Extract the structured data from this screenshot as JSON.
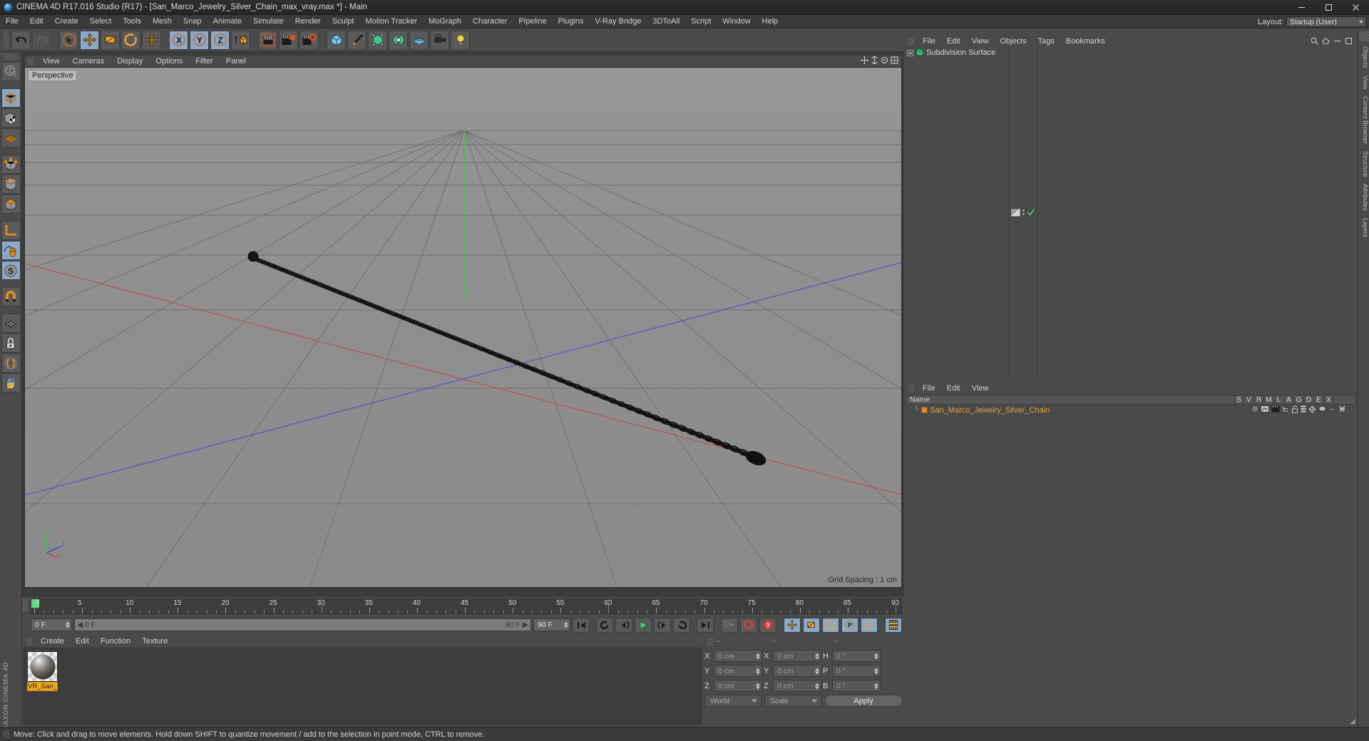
{
  "window": {
    "title": "CINEMA 4D R17.016 Studio (R17) - [San_Marco_Jewelry_Silver_Chain_max_vray.max *] - Main",
    "app_icon": "cinema4d-logo-icon",
    "minimize": "—",
    "maximize": "❐",
    "close": "✕"
  },
  "menubar": {
    "items": [
      {
        "label": "File"
      },
      {
        "label": "Edit"
      },
      {
        "label": "Create"
      },
      {
        "label": "Select"
      },
      {
        "label": "Tools"
      },
      {
        "label": "Mesh"
      },
      {
        "label": "Snap"
      },
      {
        "label": "Animate"
      },
      {
        "label": "Simulate"
      },
      {
        "label": "Render"
      },
      {
        "label": "Sculpt"
      },
      {
        "label": "Motion Tracker"
      },
      {
        "label": "MoGraph"
      },
      {
        "label": "Character"
      },
      {
        "label": "Pipeline"
      },
      {
        "label": "Plugins"
      },
      {
        "label": "V-Ray Bridge"
      },
      {
        "label": "3DToAll"
      },
      {
        "label": "Script"
      },
      {
        "label": "Window"
      },
      {
        "label": "Help"
      }
    ],
    "layout_label": "Layout:",
    "layout_value": "Startup (User)"
  },
  "toolbar": {
    "buttons": [
      {
        "name": "undo-button",
        "icon": "undo-arrow-icon",
        "state": "normal"
      },
      {
        "name": "redo-button",
        "icon": "redo-arrow-icon",
        "state": "dim"
      },
      {
        "name": "live-selection-tool",
        "icon": "cursor-circle-icon",
        "state": "normal"
      },
      {
        "name": "move-tool",
        "icon": "move-arrows-icon",
        "state": "active"
      },
      {
        "name": "scale-tool",
        "icon": "scale-box-icon",
        "state": "normal"
      },
      {
        "name": "rotate-tool",
        "icon": "rotate-ring-icon",
        "state": "normal"
      },
      {
        "name": "global-move-tool",
        "icon": "move-arrows-icon",
        "state": "normal"
      },
      {
        "name": "lock-x-axis",
        "icon": "axis-x-icon",
        "state": "active"
      },
      {
        "name": "lock-y-axis",
        "icon": "axis-y-icon",
        "state": "active"
      },
      {
        "name": "lock-z-axis",
        "icon": "axis-z-icon",
        "state": "active"
      },
      {
        "name": "world-object-coordinates",
        "icon": "world-coordinate-icon",
        "state": "normal"
      },
      {
        "name": "render-view-button",
        "icon": "clapperboard-icon",
        "state": "normal"
      },
      {
        "name": "render-to-picture-viewer",
        "icon": "clapperboard-render-icon",
        "state": "normal"
      },
      {
        "name": "render-settings",
        "icon": "clapperboard-gear-icon",
        "state": "normal"
      },
      {
        "name": "add-cube-object",
        "icon": "cube-primitive-icon",
        "state": "normal"
      },
      {
        "name": "add-spline-object",
        "icon": "pen-spline-icon",
        "state": "normal"
      },
      {
        "name": "add-generator-object",
        "icon": "generator-nurbs-icon",
        "state": "normal"
      },
      {
        "name": "add-deformer-object",
        "icon": "deformer-icon",
        "state": "normal"
      },
      {
        "name": "add-environment-object",
        "icon": "floor-environment-icon",
        "state": "normal"
      },
      {
        "name": "add-camera-object",
        "icon": "camera-icon",
        "state": "normal"
      },
      {
        "name": "add-light-object",
        "icon": "light-bulb-icon",
        "state": "normal"
      }
    ]
  },
  "left_palette": {
    "buttons": [
      {
        "name": "make-editable-tool",
        "icon": "globe-wireframe-icon",
        "state": "normal"
      },
      {
        "name": "model-mode",
        "icon": "model-cube-icon",
        "state": "active"
      },
      {
        "name": "texture-mode",
        "icon": "texture-cube-icon",
        "state": "normal"
      },
      {
        "name": "workplane-mode",
        "icon": "workplane-grid-icon",
        "state": "normal"
      },
      {
        "name": "point-mode",
        "icon": "point-cube-icon",
        "state": "normal"
      },
      {
        "name": "edge-mode",
        "icon": "edge-cube-icon",
        "state": "normal"
      },
      {
        "name": "polygon-mode",
        "icon": "polygon-cube-icon",
        "state": "normal"
      },
      {
        "name": "object-axis-mode",
        "icon": "axis-corner-icon",
        "state": "normal"
      },
      {
        "name": "enable-axis-modification",
        "icon": "mouse-axis-icon",
        "state": "active"
      },
      {
        "name": "soft-selection-tool",
        "icon": "s-circle-icon",
        "state": "active"
      },
      {
        "name": "enable-snap",
        "icon": "magnet-icon",
        "state": "normal"
      },
      {
        "name": "quantize-snap",
        "icon": "snap-grid-icon",
        "state": "normal"
      },
      {
        "name": "lock-workplane",
        "icon": "lock-icon",
        "state": "normal"
      },
      {
        "name": "open-console",
        "icon": "parentheses-icon",
        "state": "normal"
      },
      {
        "name": "python-script",
        "icon": "python-snake-icon",
        "state": "normal"
      }
    ],
    "brand": "MAXON CINEMA 4D"
  },
  "right_edge_tabs": [
    {
      "label": "Objects"
    },
    {
      "label": "View"
    },
    {
      "label": "Content Browser"
    },
    {
      "label": "Structure"
    },
    {
      "label": "Attributes"
    },
    {
      "label": "Layers"
    }
  ],
  "viewport": {
    "menus": [
      {
        "label": "View"
      },
      {
        "label": "Cameras"
      },
      {
        "label": "Display"
      },
      {
        "label": "Options"
      },
      {
        "label": "Filter"
      },
      {
        "label": "Panel"
      }
    ],
    "label": "Perspective",
    "grid_spacing": "Grid Spacing : 1 cm",
    "axis_labels": {
      "x": "X",
      "y": "Y",
      "z": "Z"
    },
    "nav_icons": [
      {
        "name": "move-camera-icon"
      },
      {
        "name": "scale-camera-icon"
      },
      {
        "name": "rotate-camera-icon"
      },
      {
        "name": "maximize-viewport-icon"
      }
    ],
    "scene_object": "silver chain model lying diagonally on ground grid"
  },
  "timeline": {
    "ticks": [
      {
        "label": "0",
        "frame": 0
      },
      {
        "label": "5",
        "frame": 5
      },
      {
        "label": "10",
        "frame": 10
      },
      {
        "label": "15",
        "frame": 15
      },
      {
        "label": "20",
        "frame": 20
      },
      {
        "label": "25",
        "frame": 25
      },
      {
        "label": "30",
        "frame": 30
      },
      {
        "label": "35",
        "frame": 35
      },
      {
        "label": "40",
        "frame": 40
      },
      {
        "label": "45",
        "frame": 45
      },
      {
        "label": "50",
        "frame": 50
      },
      {
        "label": "55",
        "frame": 55
      },
      {
        "label": "60",
        "frame": 60
      },
      {
        "label": "65",
        "frame": 65
      },
      {
        "label": "70",
        "frame": 70
      },
      {
        "label": "75",
        "frame": 75
      },
      {
        "label": "80",
        "frame": 80
      },
      {
        "label": "85",
        "frame": 85
      },
      {
        "label": "90",
        "frame": 90
      }
    ],
    "end_field": "0 F",
    "current_frame": "0 F",
    "range_start": "0 F",
    "range_end": "90 F",
    "max_frame": "90 F",
    "transport": [
      {
        "name": "go-to-start-button",
        "icon": "skip-start-icon"
      },
      {
        "name": "play-backwards-button",
        "icon": "rewind-loop-icon"
      },
      {
        "name": "previous-frame-button",
        "icon": "step-back-icon"
      },
      {
        "name": "play-button",
        "icon": "play-triangle-icon"
      },
      {
        "name": "next-frame-button",
        "icon": "step-forward-icon"
      },
      {
        "name": "play-forwards-button",
        "icon": "forward-loop-icon"
      },
      {
        "name": "go-to-end-button",
        "icon": "skip-end-icon"
      },
      {
        "name": "record-active-objects-button",
        "icon": "key-icon"
      },
      {
        "name": "autokeying-button",
        "icon": "record-circle-icon"
      },
      {
        "name": "keyframe-selection-button",
        "icon": "question-circle-icon"
      },
      {
        "name": "position-key-toggle",
        "icon": "move-arrows-icon"
      },
      {
        "name": "scale-key-toggle",
        "icon": "scale-box-icon"
      },
      {
        "name": "rotation-key-toggle",
        "icon": "rotate-ring-icon"
      },
      {
        "name": "param-key-toggle",
        "icon": "p-circle-icon"
      },
      {
        "name": "point-level-animation-toggle",
        "icon": "dots-grid-icon"
      },
      {
        "name": "timeline-strip-button",
        "icon": "film-strip-icon"
      }
    ]
  },
  "material_manager": {
    "menus": [
      {
        "label": "Create"
      },
      {
        "label": "Edit"
      },
      {
        "label": "Function"
      },
      {
        "label": "Texture"
      }
    ],
    "materials": [
      {
        "name": "VR_San_",
        "preview": "silver-chrome-sphere"
      }
    ]
  },
  "coordinates_manager": {
    "headers": [
      "--",
      "--",
      "--"
    ],
    "rows": [
      {
        "pos_label": "X",
        "pos_value": "0 cm",
        "size_label": "X",
        "size_value": "0 cm",
        "rot_label": "H",
        "rot_value": "0 °"
      },
      {
        "pos_label": "Y",
        "pos_value": "0 cm",
        "size_label": "Y",
        "size_value": "0 cm",
        "rot_label": "P",
        "rot_value": "0 °"
      },
      {
        "pos_label": "Z",
        "pos_value": "0 cm",
        "size_label": "Z",
        "size_value": "0 cm",
        "rot_label": "B",
        "rot_value": "0 °"
      }
    ],
    "coord_system": "World",
    "transform_mode": "Scale",
    "apply_label": "Apply"
  },
  "object_manager": {
    "menus": [
      {
        "label": "File"
      },
      {
        "label": "Edit"
      },
      {
        "label": "View"
      },
      {
        "label": "Objects"
      },
      {
        "label": "Tags"
      },
      {
        "label": "Bookmarks"
      }
    ],
    "tools": [
      {
        "name": "search-icon"
      },
      {
        "name": "home-icon"
      },
      {
        "name": "minimize-panel-icon"
      },
      {
        "name": "maximize-panel-icon"
      }
    ],
    "items": [
      {
        "label": "Subdivision Surface",
        "icon": "subdivision-surface-icon",
        "expandable": true,
        "tags": [
          {
            "name": "phong-tag-icon"
          },
          {
            "name": "visibility-dots-icon"
          },
          {
            "name": "check-icon"
          }
        ]
      }
    ]
  },
  "sub_manager": {
    "menus": [
      {
        "label": "File"
      },
      {
        "label": "Edit"
      },
      {
        "label": "View"
      }
    ],
    "columns": [
      "Name",
      "S",
      "V",
      "R",
      "M",
      "L",
      "A",
      "G",
      "D",
      "E",
      "X"
    ],
    "rows": [
      {
        "name": "San_Marco_Jewelry_Silver_Chain",
        "color": "#e8a13a",
        "tags": [
          "sphere-icon",
          "screen-icon",
          "clapperboard-icon",
          "hierarchy-icon",
          "unlock-icon",
          "layers-icon",
          "deform-icon",
          "disc-icon",
          "ellipse-icon",
          "bones-icon"
        ]
      }
    ]
  },
  "statusbar": {
    "message": "Move: Click and drag to move elements. Hold down SHIFT to quantize movement / add to the selection in point mode, CTRL to remove."
  },
  "colors": {
    "accent_orange": "#e8a13a",
    "active_blue": "#8aa8c8",
    "panel_gray": "#4a4a4a",
    "viewport_gray": "#8d8d8d",
    "green_axis": "#3fbf4f",
    "red_axis": "#c04a52",
    "blue_axis": "#4a4ac0"
  }
}
